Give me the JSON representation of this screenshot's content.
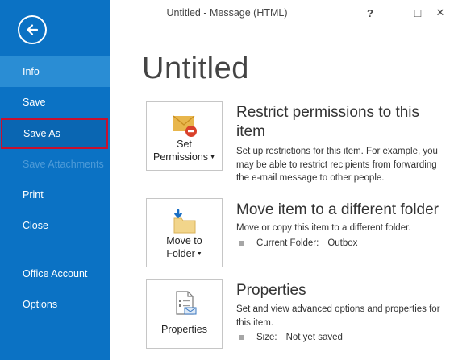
{
  "window": {
    "title": "Untitled - Message (HTML)",
    "help_glyph": "?",
    "minimize_glyph": "–",
    "maximize_glyph": "□",
    "close_glyph": "✕"
  },
  "nav": {
    "back_icon": "back-arrow-icon",
    "items": [
      {
        "label": "Info",
        "state": "active"
      },
      {
        "label": "Save",
        "state": "normal"
      },
      {
        "label": "Save As",
        "state": "focused"
      },
      {
        "label": "Save Attachments",
        "state": "disabled"
      },
      {
        "label": "Print",
        "state": "normal"
      },
      {
        "label": "Close",
        "state": "normal"
      },
      {
        "label": "Office Account",
        "state": "normal"
      },
      {
        "label": "Options",
        "state": "normal"
      }
    ]
  },
  "page": {
    "title": "Untitled"
  },
  "sections": [
    {
      "tile_line1": "Set",
      "tile_line2": "Permissions",
      "tile_has_dropdown": true,
      "icon": "envelope-restricted-icon",
      "title": "Restrict permissions to this item",
      "description": "Set up restrictions for this item. For example, you may be able to restrict recipients from forwarding the e-mail message to other people."
    },
    {
      "tile_line1": "Move to",
      "tile_line2": "Folder",
      "tile_has_dropdown": true,
      "icon": "move-to-folder-icon",
      "title": "Move item to a different folder",
      "description": "Move or copy this item to a different folder.",
      "detail_label": "Current Folder:",
      "detail_value": "Outbox"
    },
    {
      "tile_line1": "Properties",
      "tile_has_dropdown": false,
      "icon": "properties-document-icon",
      "title": "Properties",
      "description": "Set and view advanced options and properties for this item.",
      "detail_label": "Size:",
      "detail_value": "Not yet saved"
    }
  ],
  "colors": {
    "backstage_blue": "#0b72c4",
    "active_item": "#2a8dd4",
    "focus_outline": "#c8102e",
    "envelope_yellow": "#e8b64c",
    "restrict_red": "#d9412b",
    "arrow_blue": "#1a6fc4"
  }
}
